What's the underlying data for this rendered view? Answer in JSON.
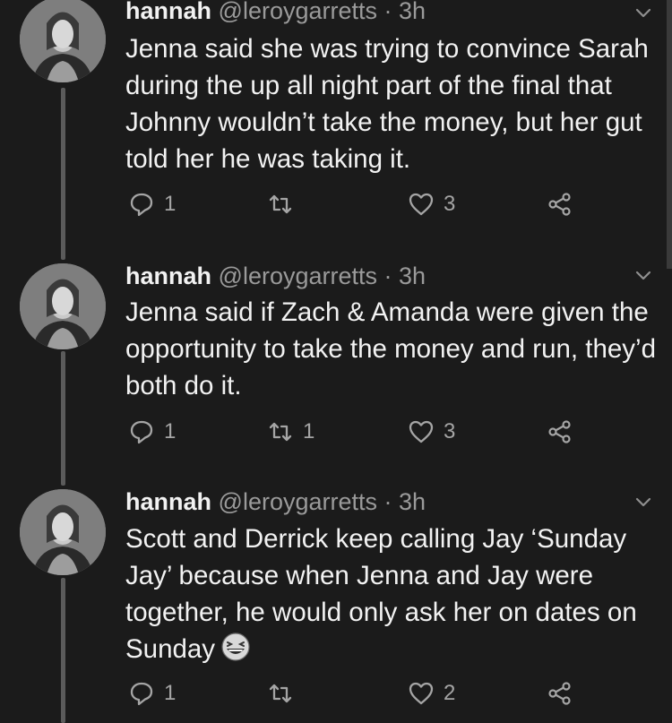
{
  "tweets": [
    {
      "name": "hannah",
      "handle": "@leroygarretts · 3h",
      "text": "Jenna said she was trying to convince Sarah during the up all night part of the final that Johnny wouldn’t take the money, but her gut told her he was taking it.",
      "replies": "1",
      "retweets": "",
      "likes": "3"
    },
    {
      "name": "hannah",
      "handle": "@leroygarretts · 3h",
      "text": "Jenna said if Zach & Amanda were given the opportunity to take the money and run, they’d both do it.",
      "replies": "1",
      "retweets": "1",
      "likes": "3"
    },
    {
      "name": "hannah",
      "handle": "@leroygarretts · 3h",
      "text": "Scott and Derrick keep calling Jay ‘Sunday Jay’ because when Jenna and Jay were together, he would only ask her on dates on Sunday",
      "replies": "1",
      "retweets": "",
      "likes": "2",
      "emoji": "grinning-squinting-face"
    }
  ],
  "colors": {
    "background": "#1b1b1b",
    "text": "#f2f2f2",
    "secondary": "#9a9a9a",
    "thread": "#5b5b5b"
  }
}
